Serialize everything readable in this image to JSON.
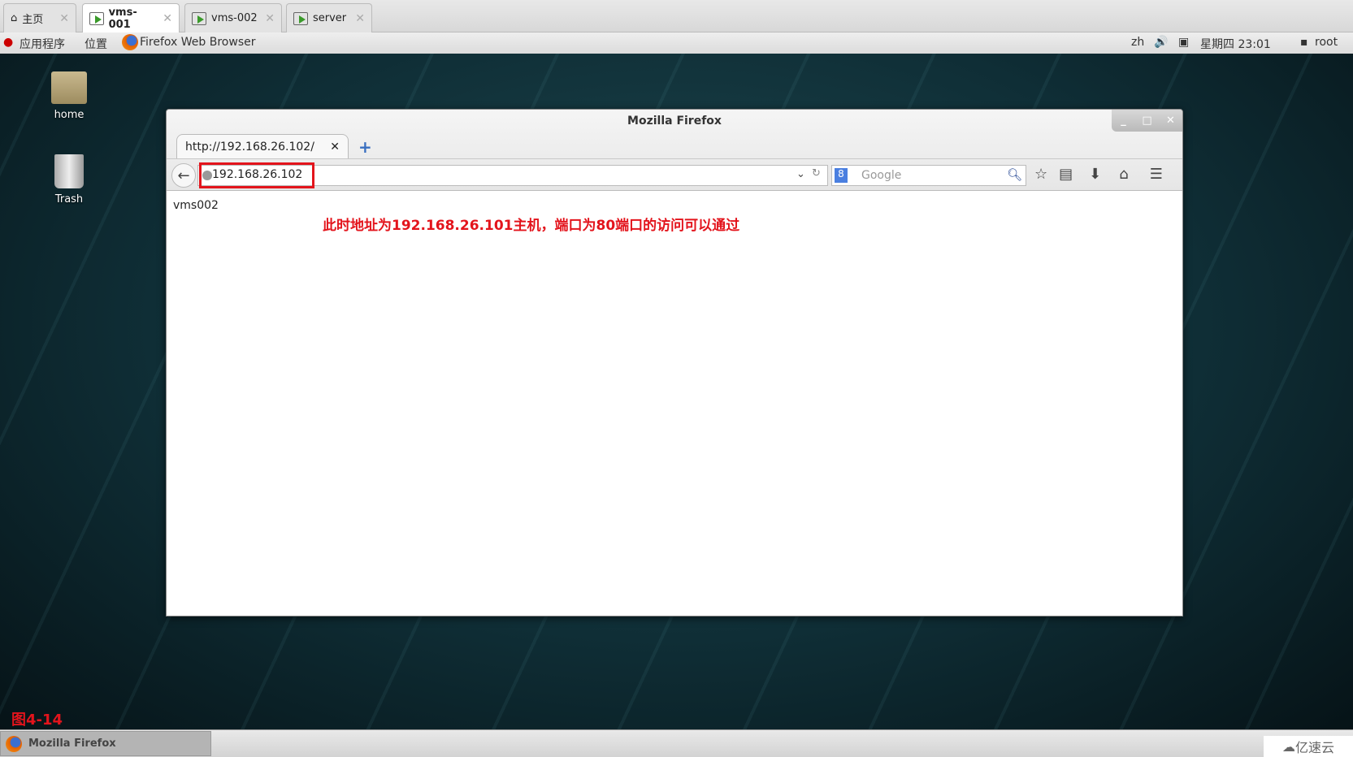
{
  "vm_tabs": [
    {
      "label": "主页",
      "icon": "home-icon"
    },
    {
      "label": "vms-001",
      "icon": "vm-icon",
      "active": true
    },
    {
      "label": "vms-002",
      "icon": "vm-icon"
    },
    {
      "label": "server",
      "icon": "vm-icon"
    }
  ],
  "panel": {
    "applications": "应用程序",
    "places": "位置",
    "active_app": "Firefox Web Browser",
    "lang": "zh",
    "datetime": "星期四 23:01",
    "user": "root"
  },
  "desktop": {
    "icons": [
      {
        "label": "home"
      },
      {
        "label": "Trash"
      }
    ],
    "figure_label": "图4-14"
  },
  "firefox": {
    "title": "Mozilla Firefox",
    "tab_title": "http://192.168.26.102/",
    "url": "192.168.26.102",
    "search_placeholder": "Google",
    "page_text": "vms002",
    "annotation": "此时地址为192.168.26.101主机，端口为80端口的访问可以通过",
    "annotation_color": "#e3141c"
  },
  "taskbar": {
    "window_button": "Mozilla Firefox"
  },
  "watermark": "亿速云"
}
